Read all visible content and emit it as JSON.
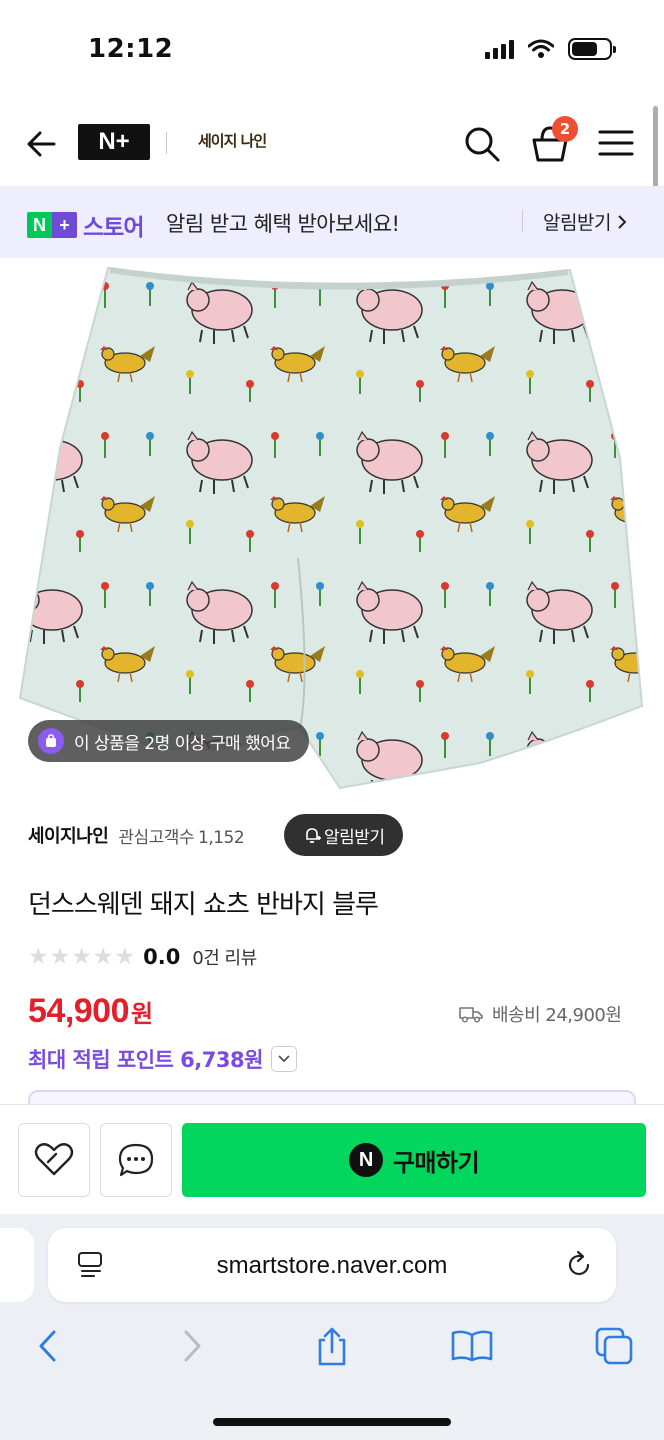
{
  "status": {
    "time": "12:12"
  },
  "nav": {
    "logo_text": "N+",
    "shop_logo": "세이지 나인",
    "cart_count": "2"
  },
  "promo": {
    "store_label": "스토어",
    "text": "알림 받고 혜택 받아보세요!",
    "cta": "알림받기"
  },
  "product": {
    "buyers_notice": "이 상품을 2명 이상 구매 했어요",
    "seller_name": "세이지나인",
    "fans_label": "관심고객수",
    "fans_count": "1,152",
    "notify_label": "알림받기",
    "title": "던스스웨덴 돼지 쇼츠 반바지 블루",
    "rating": "0.0",
    "rating_stars": 0,
    "review_count": "0건 리뷰",
    "price": "54,900",
    "price_unit": "원",
    "shipping": "배송비 24,900원",
    "points": "최대 적립 포인트 6,738원"
  },
  "actions": {
    "buy_label": "구매하기"
  },
  "browser": {
    "url": "smartstore.naver.com"
  },
  "colors": {
    "accent_green": "#03d65c",
    "price_red": "#e2202c",
    "points_purple": "#7a4be0"
  }
}
